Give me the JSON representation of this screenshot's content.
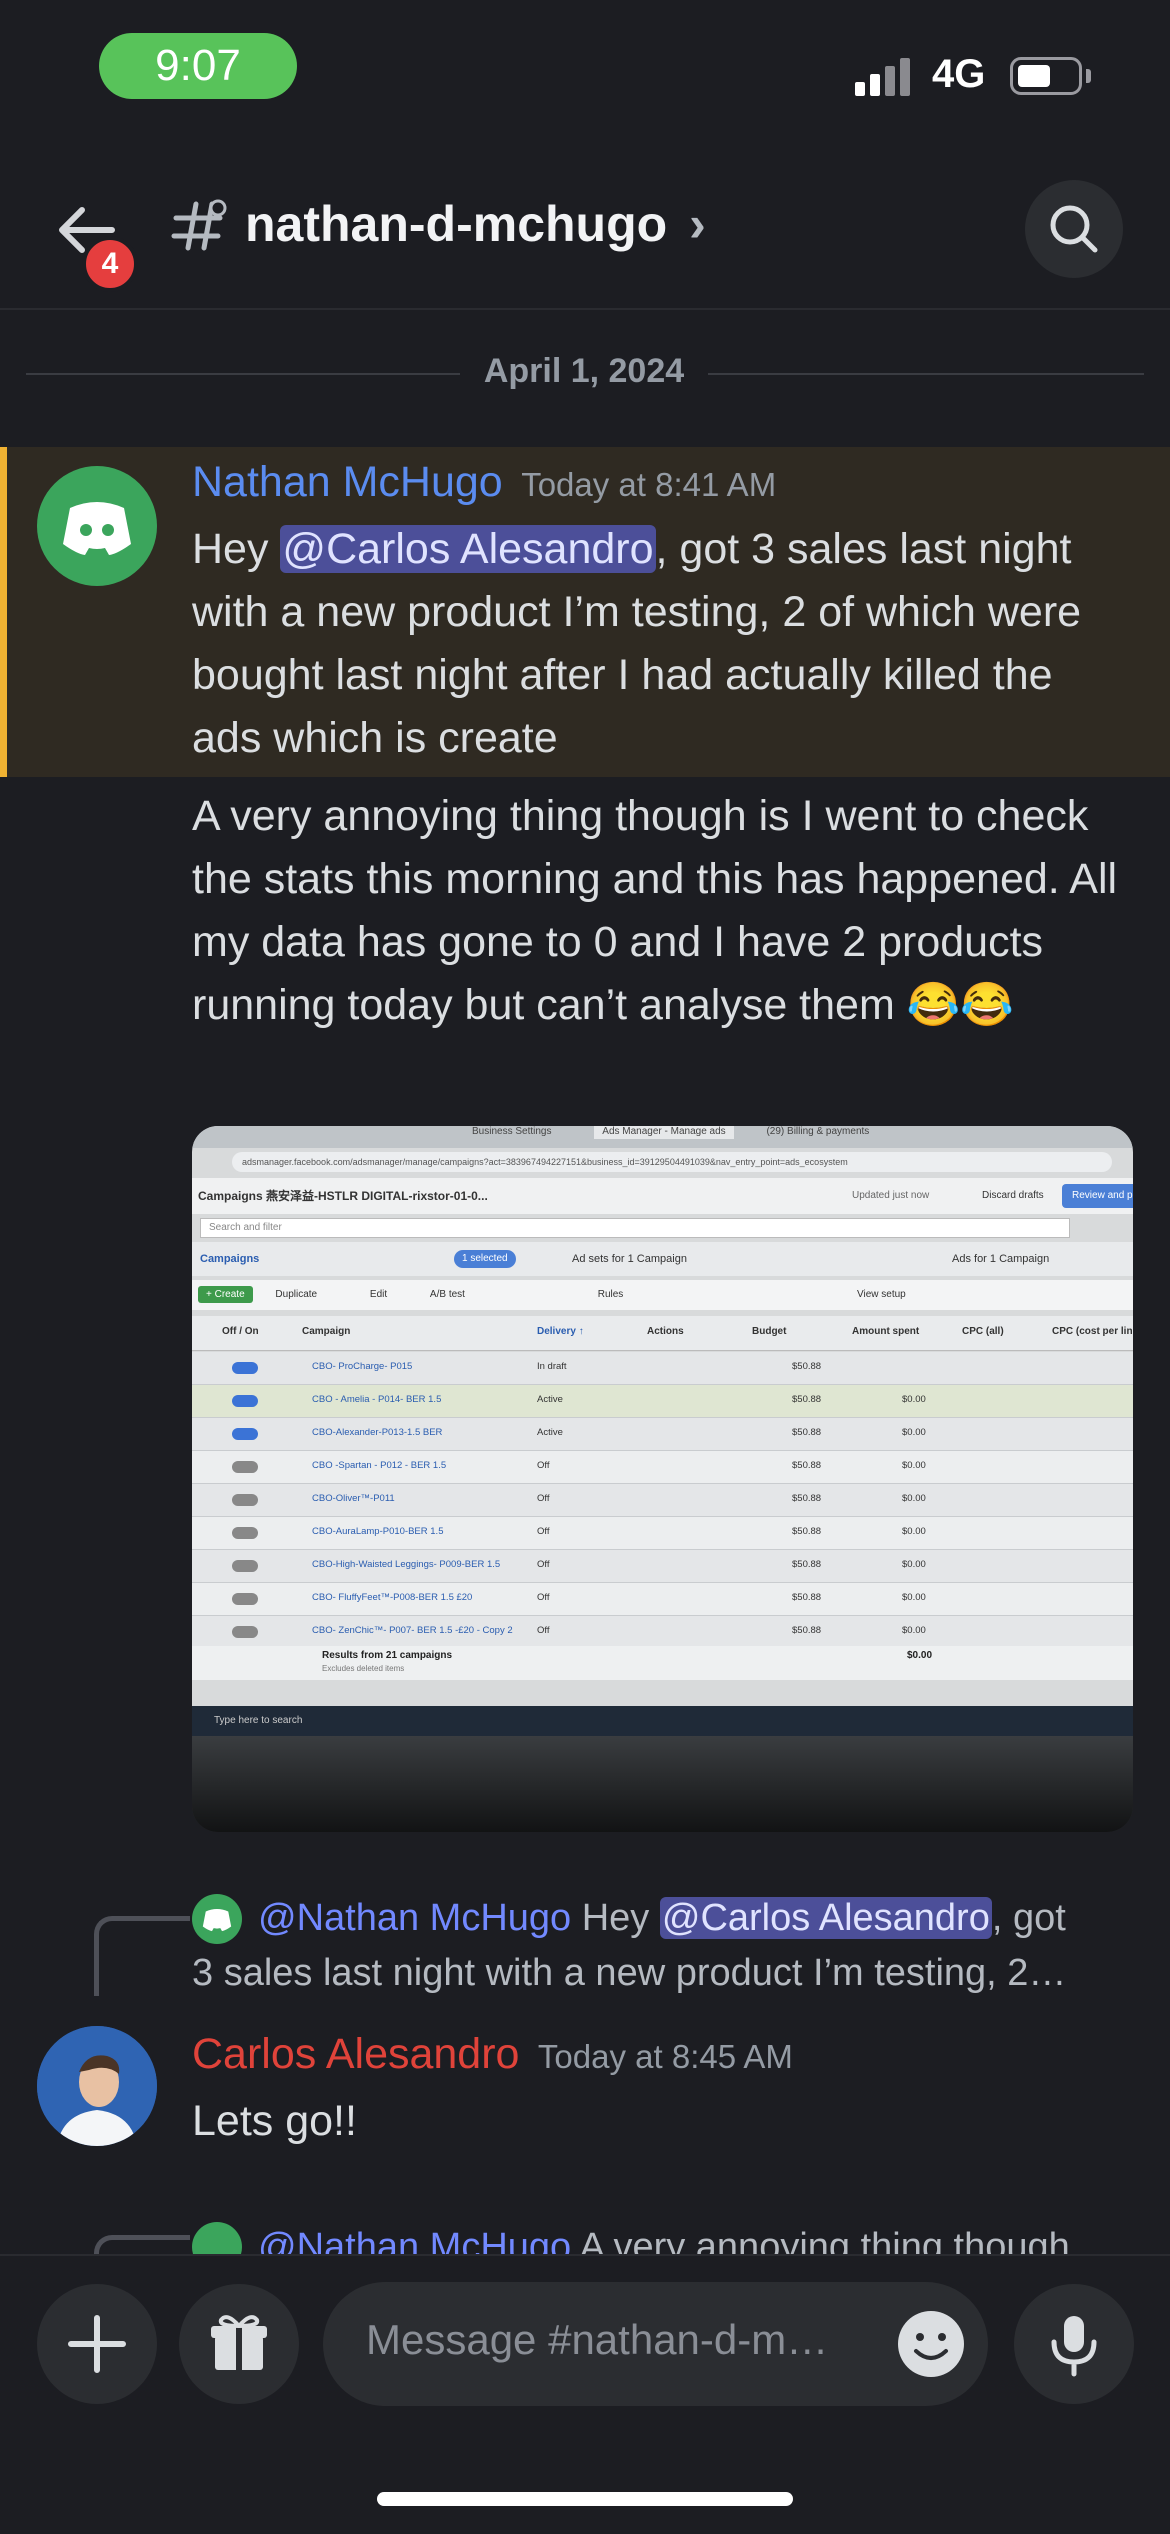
{
  "status_bar": {
    "time": "9:07",
    "network": "4G"
  },
  "header": {
    "notification_count": "4",
    "channel_name": "nathan-d-mchugo",
    "chevron": "›"
  },
  "date_divider": "April 1, 2024",
  "messages": [
    {
      "author": "Nathan McHugo",
      "author_color": "#5b8cf0",
      "timestamp": "Today at 8:41 AM",
      "text_before_mention": "Hey ",
      "mention": "@Carlos Alesandro",
      "text_after_mention": ", got 3 sales last night with a new product I’m testing, 2 of which were bought last night after I had actually killed the ads which is create",
      "followup_text": "A very annoying thing though is I went to check the stats this morning and this has happened. All my data has gone to 0 and I have 2 products running today but can’t analyse them 😂😂"
    },
    {
      "reply_to_author": "@Nathan McHugo",
      "reply_text_before": "Hey ",
      "reply_mention": "@Carlos Alesandro",
      "reply_text_after": ", got",
      "reply_text_line2": "3 sales last night with a new product I’m testing, 2…",
      "author": "Carlos Alesandro",
      "author_color": "#e0433a",
      "timestamp": "Today at 8:45 AM",
      "text": "Lets go!!"
    },
    {
      "reply_to_author": "@Nathan McHugo",
      "reply_text": "A very annoying thing though"
    }
  ],
  "screenshot_image": {
    "url": "adsmanager.facebook.com/adsmanager/manage/campaigns?act=383967494227151&business_id=39129504491039&nav_entry_point=ads_ecosystem",
    "tabs": [
      "Business Settings",
      "Ads Manager - Manage ads",
      "(29) Billing & payments"
    ],
    "account": "Campaigns   燕安泽益-HSTLR DIGITAL-rixstor-01-0...",
    "updated": "Updated just now",
    "discard": "Discard drafts",
    "review": "Review and p",
    "search": "Search and filter",
    "panel_campaigns": "Campaigns",
    "selected": "1 selected",
    "panel_adsets": "Ad sets for 1 Campaign",
    "panel_ads": "Ads for 1 Campaign",
    "toolbar": [
      "+ Create",
      "Duplicate",
      "Edit",
      "A/B test",
      "Rules"
    ],
    "view_setup": "View setup",
    "columns": [
      "Off / On",
      "Campaign",
      "Delivery ↑",
      "Actions",
      "Budget",
      "Amount spent",
      "CPC (all)",
      "CPC (cost per link click)"
    ],
    "rows": [
      {
        "name": "CBO- ProCharge- P015",
        "delivery": "In draft",
        "budget": "$50.88",
        "spent": ""
      },
      {
        "name": "CBO - Amelia - P014- BER 1.5",
        "delivery": "Active",
        "budget": "$50.88",
        "spent": "$0.00"
      },
      {
        "name": "CBO-Alexander-P013-1.5 BER",
        "delivery": "Active",
        "budget": "$50.88",
        "spent": "$0.00"
      },
      {
        "name": "CBO -Spartan - P012 - BER 1.5",
        "delivery": "Off",
        "budget": "$50.88",
        "spent": "$0.00"
      },
      {
        "name": "CBO-Oliver™-P011",
        "delivery": "Off",
        "budget": "$50.88",
        "spent": "$0.00"
      },
      {
        "name": "CBO-AuraLamp-P010-BER 1.5",
        "delivery": "Off",
        "budget": "$50.88",
        "spent": "$0.00"
      },
      {
        "name": "CBO-High-Waisted Leggings- P009-BER 1.5",
        "delivery": "Off",
        "budget": "$50.88",
        "spent": "$0.00"
      },
      {
        "name": "CBO- FluffyFeet™-P008-BER 1.5 £20",
        "delivery": "Off",
        "budget": "$50.88",
        "spent": "$0.00"
      },
      {
        "name": "CBO- ZenChic™- P007- BER 1.5 -£20 - Copy 2",
        "delivery": "Off",
        "budget": "$50.88",
        "spent": "$0.00"
      }
    ],
    "results": "Results from 21 campaigns",
    "results_sub": "Excludes deleted items",
    "total_spent": "$0.00",
    "taskbar_search": "Type here to search"
  },
  "input": {
    "placeholder": "Message #nathan-d-m…"
  },
  "colors": {
    "background": "#1c1d22",
    "mention_highlight": "#2f2a22",
    "accent_bar": "#f0b232",
    "link_blue": "#5b8cf0"
  },
  "icons": [
    "back-arrow-icon",
    "channel-hash-icon",
    "search-icon",
    "discord-logo-icon",
    "plus-icon",
    "gift-icon",
    "emoji-icon",
    "microphone-icon"
  ]
}
